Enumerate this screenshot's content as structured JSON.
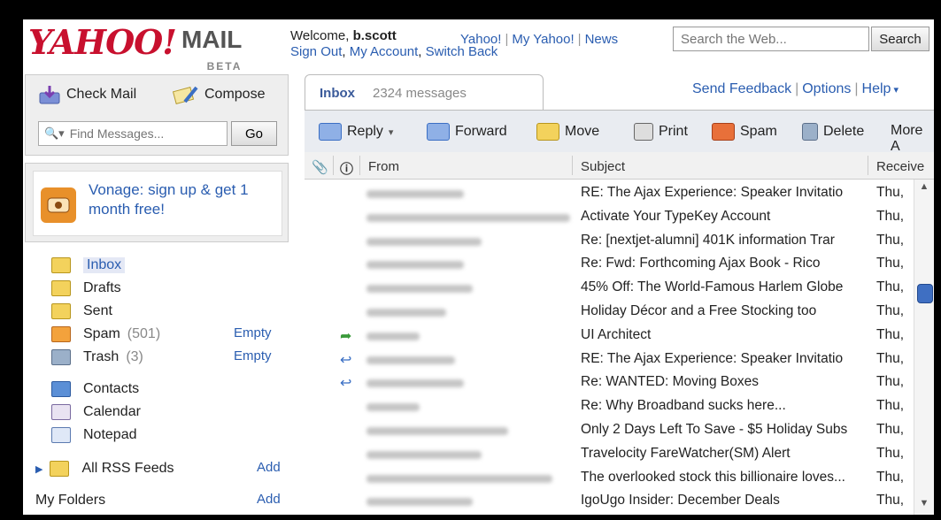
{
  "header": {
    "logo_yahoo": "YAHOO!",
    "logo_mail": "MAIL",
    "logo_beta": "BETA",
    "welcome_prefix": "Welcome,",
    "username": "b.scott",
    "account_links": [
      "Sign Out",
      "My Account",
      "Switch Back"
    ],
    "top_links": [
      "Yahoo!",
      "My Yahoo!",
      "News"
    ],
    "search_placeholder": "Search the Web...",
    "search_button": "Search"
  },
  "left": {
    "check_mail": "Check Mail",
    "compose": "Compose",
    "find_placeholder": "Find Messages...",
    "go": "Go",
    "promo": "Vonage: sign up & get 1 month free!",
    "folders": [
      {
        "label": "Inbox",
        "count": ""
      },
      {
        "label": "Drafts",
        "count": ""
      },
      {
        "label": "Sent",
        "count": ""
      },
      {
        "label": "Spam",
        "count": "(501)",
        "action": "Empty"
      },
      {
        "label": "Trash",
        "count": "(3)",
        "action": "Empty"
      }
    ],
    "apps": [
      "Contacts",
      "Calendar",
      "Notepad"
    ],
    "rss": "All RSS Feeds",
    "rss_action": "Add",
    "my_folders": "My Folders",
    "my_folders_action": "Add"
  },
  "main": {
    "tab_label": "Inbox",
    "tab_count": "2324 messages",
    "right_links": [
      "Send Feedback",
      "Options",
      "Help"
    ],
    "toolbar": [
      "Reply",
      "Forward",
      "Move",
      "Print",
      "Spam",
      "Delete",
      "More A"
    ],
    "columns": [
      "From",
      "Subject",
      "Receive"
    ],
    "messages": [
      {
        "subject": "RE: The Ajax Experience: Speaker Invitatio",
        "date": "Thu,",
        "flag": ""
      },
      {
        "subject": "Activate Your TypeKey Account",
        "date": "Thu,",
        "flag": ""
      },
      {
        "subject": "Re: [nextjet-alumni] 401K information Trar",
        "date": "Thu,",
        "flag": ""
      },
      {
        "subject": "Re: Fwd: Forthcoming Ajax Book - Rico",
        "date": "Thu,",
        "flag": ""
      },
      {
        "subject": "45% Off: The World-Famous Harlem Globe",
        "date": "Thu,",
        "flag": ""
      },
      {
        "subject": "Holiday Décor and a Free Stocking too",
        "date": "Thu,",
        "flag": ""
      },
      {
        "subject": "UI Architect",
        "date": "Thu,",
        "flag": "forwarded"
      },
      {
        "subject": "RE: The Ajax Experience: Speaker Invitatio",
        "date": "Thu,",
        "flag": "replied"
      },
      {
        "subject": "Re: WANTED: Moving Boxes",
        "date": "Thu,",
        "flag": "replied"
      },
      {
        "subject": "Re: Why Broadband sucks here...",
        "date": "Thu,",
        "flag": ""
      },
      {
        "subject": "Only 2 Days Left To Save - $5 Holiday Subs",
        "date": "Thu,",
        "flag": ""
      },
      {
        "subject": "Travelocity FareWatcher(SM) Alert",
        "date": "Thu,",
        "flag": ""
      },
      {
        "subject": "The overlooked stock this billionaire loves...",
        "date": "Thu,",
        "flag": ""
      },
      {
        "subject": "IgoUgo Insider: December Deals",
        "date": "Thu,",
        "flag": ""
      }
    ]
  }
}
